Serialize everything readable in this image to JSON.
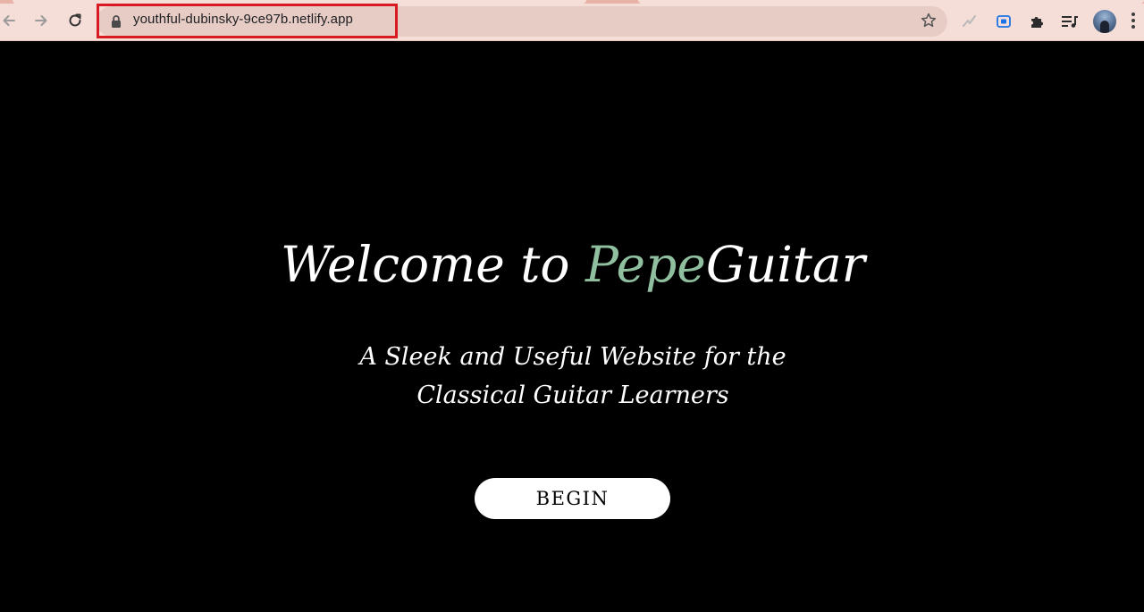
{
  "browser": {
    "url": "youthful-dubinsky-9ce97b.netlify.app",
    "highlight_color": "#d81a22",
    "toolbar_bg": "#f6ded8",
    "icons": {
      "back": "back-arrow-icon",
      "forward": "forward-arrow-icon",
      "reload": "reload-icon",
      "lock": "lock-icon",
      "bookmark": "star-icon",
      "extension_1": "activity-pulse-icon",
      "extension_2": "screen-capture-icon",
      "extensions": "puzzle-piece-icon",
      "media": "media-queue-icon",
      "profile": "avatar",
      "menu": "kebab-menu-icon"
    }
  },
  "hero": {
    "title_prefix": "Welcome to ",
    "title_accent": "Pepe",
    "title_suffix": "Guitar",
    "accent_color": "#8fbf9f",
    "subtitle": "A Sleek and Useful Website for the Classical Guitar Learners",
    "button_label": "BEGIN"
  }
}
